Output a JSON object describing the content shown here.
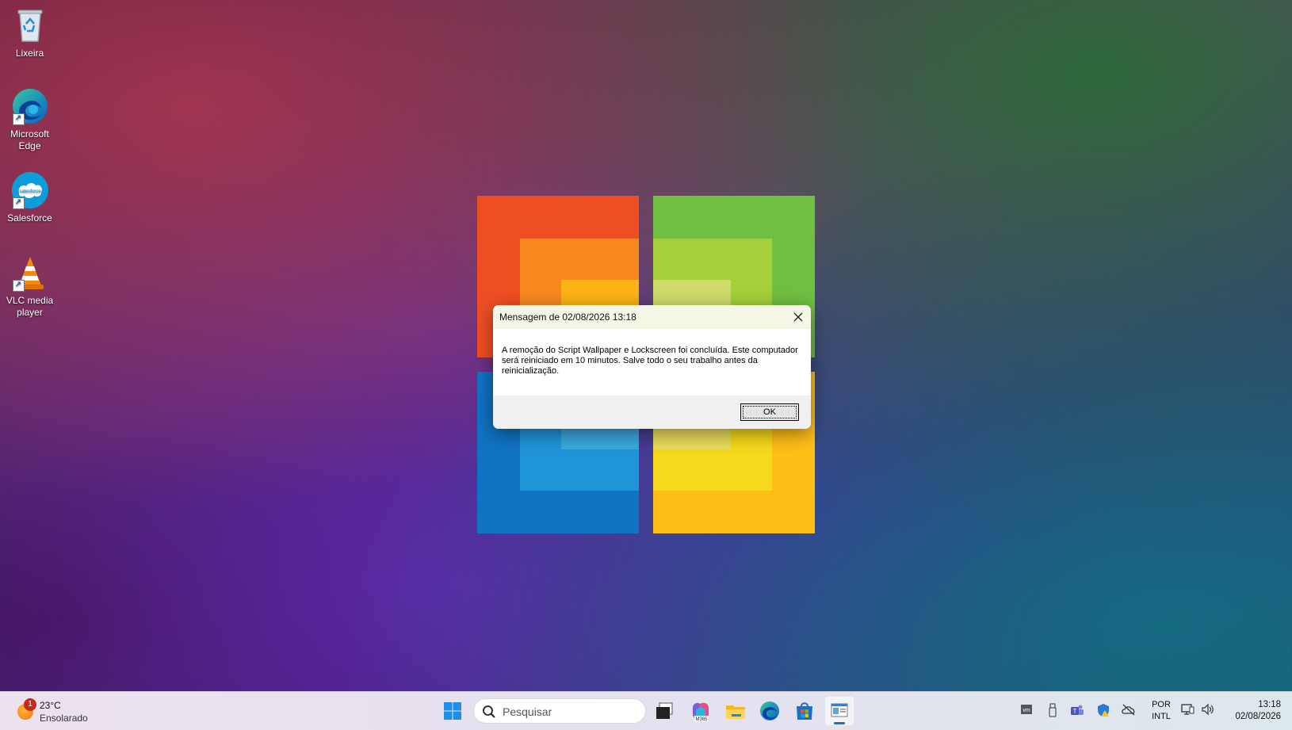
{
  "desktop": {
    "icons": [
      {
        "label": "Lixeira",
        "icon": "recycle-bin-icon"
      },
      {
        "label": "Microsoft Edge",
        "icon": "edge-icon"
      },
      {
        "label": "Salesforce",
        "icon": "salesforce-icon"
      },
      {
        "label": "VLC media player",
        "icon": "vlc-icon"
      }
    ],
    "salesforce_logo_text": "salesforce"
  },
  "dialog": {
    "title": "Mensagem de  02/08/2026 13:18",
    "message": "A remoção do Script Wallpaper e Lockscreen foi concluída. Este computador será reiniciado em 10 minutos. Salve todo o seu trabalho antes da reinicialização.",
    "ok_label": "OK",
    "close_icon": "close-icon"
  },
  "taskbar": {
    "weather": {
      "temp": "23°C",
      "desc": "Ensolarado",
      "badge": "1"
    },
    "search_placeholder": "Pesquisar",
    "apps": [
      "start-icon",
      "task-view-icon",
      "m365-copilot-icon",
      "file-explorer-icon",
      "edge-icon",
      "store-icon",
      "active-window-icon"
    ],
    "m365_label": "M365",
    "tray": [
      "vmware-icon",
      "usb-icon",
      "teams-icon",
      "defender-warning-icon",
      "onedrive-offline-icon"
    ],
    "lang_line1": "POR",
    "lang_line2": "INTL",
    "time": "13:18",
    "date": "02/08/2026"
  },
  "colors": {
    "logo_red": "#ef4e23",
    "logo_green": "#6fbd3f",
    "logo_blue": "#1273c4",
    "logo_yellow": "#ffbd16",
    "accent": "#1a6fd0"
  }
}
